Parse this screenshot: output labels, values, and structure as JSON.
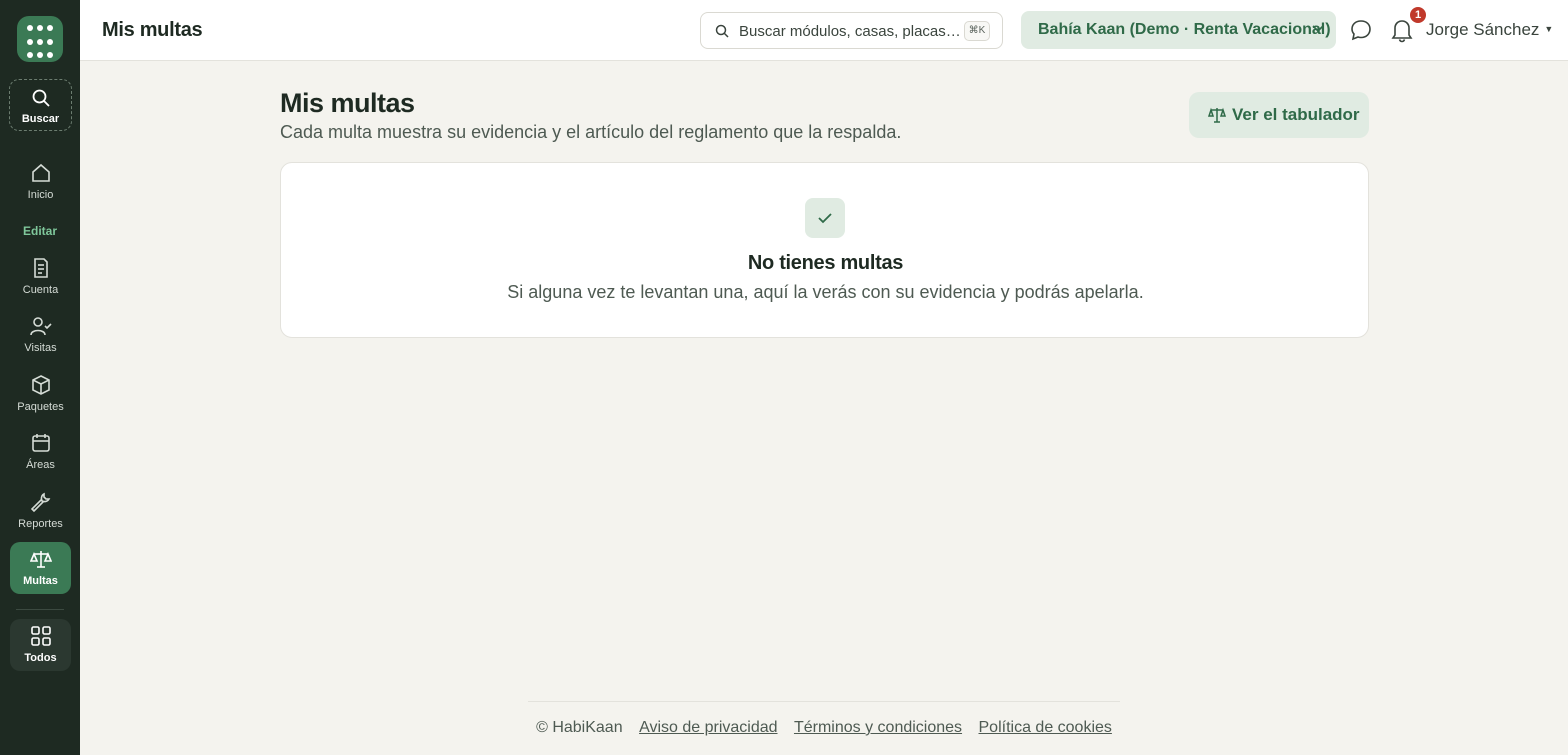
{
  "topbar": {
    "title": "Mis multas",
    "search_placeholder": "Buscar módulos, casas, placas…",
    "shortcut": "⌘K",
    "property": "Bahía Kaan (Demo · Renta Vacacional)",
    "notifications_count": "1",
    "user_name": "Jorge Sánchez"
  },
  "sidebar": {
    "search_label": "Buscar",
    "edit_label": "Editar",
    "items": [
      {
        "label": "Inicio",
        "icon": "home-icon"
      },
      {
        "label": "Cuenta",
        "icon": "document-icon"
      },
      {
        "label": "Visitas",
        "icon": "user-check-icon"
      },
      {
        "label": "Paquetes",
        "icon": "package-icon"
      },
      {
        "label": "Áreas",
        "icon": "calendar-icon"
      },
      {
        "label": "Reportes",
        "icon": "wrench-icon"
      },
      {
        "label": "Multas",
        "icon": "scale-icon",
        "active": true
      },
      {
        "label": "Todos",
        "icon": "grid-icon"
      }
    ]
  },
  "main": {
    "heading": "Mis multas",
    "subtitle": "Cada multa muestra su evidencia y el artículo del reglamento que la respalda.",
    "tabulator_button": "Ver el tabulador",
    "empty_title": "No tienes multas",
    "empty_subtitle": "Si alguna vez te levantan una, aquí la verás con su evidencia y podrás apelarla."
  },
  "footer": {
    "copyright": "© HabiKaan",
    "privacy": "Aviso de privacidad",
    "terms": "Términos y condiciones",
    "cookies": "Política de cookies"
  },
  "colors": {
    "sidebar_bg": "#1e2a22",
    "accent": "#3b7a55",
    "accent_soft": "#e0ebe2",
    "page_bg": "#f4f3ee",
    "badge": "#c0392b"
  }
}
